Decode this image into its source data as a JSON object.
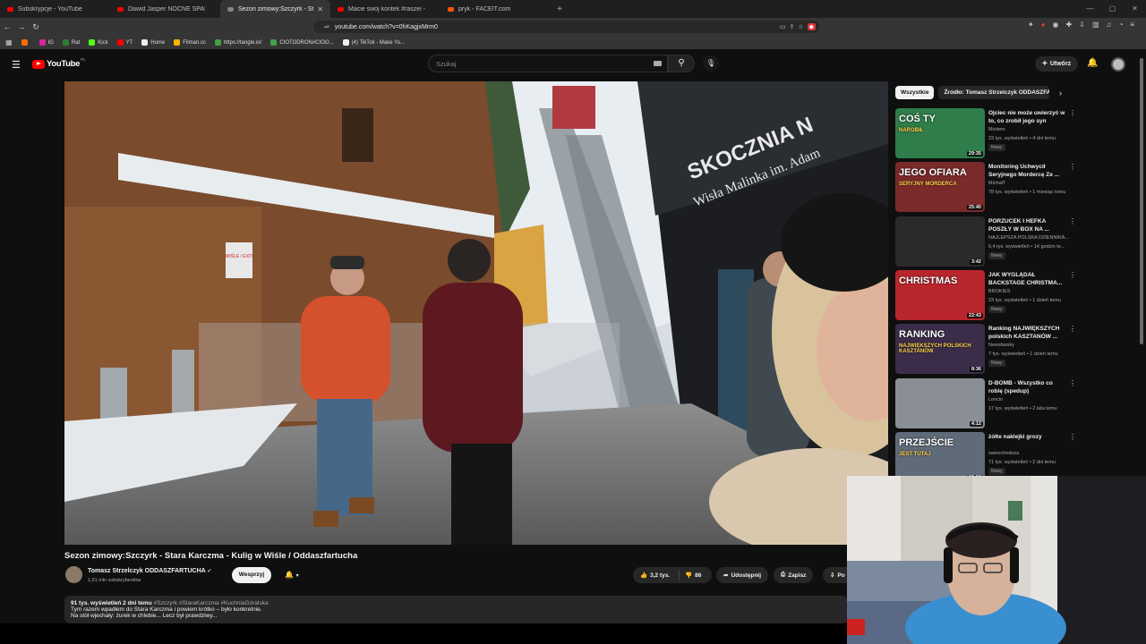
{
  "browser": {
    "tabs": [
      {
        "label": "Subskrypcje - YouTube"
      },
      {
        "label": "Dawid Jasper NOCNE SPANIE #61 -"
      },
      {
        "label": "Sezon zimowy:Szczyrk - Stara",
        "active": true
      },
      {
        "label": "Macie swój kontek #raszei - YouTube"
      },
      {
        "label": "pryk - FACEIT.com"
      }
    ],
    "new_tab": "+",
    "url": "youtube.com/watch?v=0hKagjxMrm0",
    "bookmarks": [
      {
        "label": "",
        "color": "#ff6d00"
      },
      {
        "label": "IG",
        "color": "#d6249f"
      },
      {
        "label": "Rat",
        "color": "#2e7d32"
      },
      {
        "label": "Kick",
        "color": "#53fc18"
      },
      {
        "label": "YT",
        "color": "#ff0000"
      },
      {
        "label": "Home",
        "color": "#eeeeee"
      },
      {
        "label": "Filman.cc",
        "color": "#ffb300"
      },
      {
        "label": "https://tangle.io/",
        "color": "#43a047"
      },
      {
        "label": "CIOTODRON#CIOO...",
        "color": "#43a047"
      },
      {
        "label": "(4) TikTok - Make Yo...",
        "color": "#eeeeee"
      }
    ]
  },
  "youtube": {
    "logo_text": "YouTube",
    "country": "PL",
    "search_placeholder": "Szukaj",
    "create_label": "Utwórz"
  },
  "video": {
    "title": "Sezon zimowy:Szczyrk - Stara Karczma - Kulig w Wiśle / Oddaszfartucha",
    "channel": "Tomasz Strzelczyk ODDASZFARTUCHA",
    "subscribers": "1,61 mln subskrybentów",
    "support_label": "Wesprzyj",
    "likes": "3,2 tys.",
    "dislikes": "86",
    "share_label": "Udostępnij",
    "save_label": "Zapisz",
    "download_label": "Po",
    "sign_left": "WIŚLE / EXIT",
    "sign_building": "SKOCZNIA N",
    "sign_building_2": "Wisła Malinka im. Adam",
    "description": {
      "meta": "91 tys. wyświetleń  2 dni temu",
      "tags": "#Szczyrk #StaraKarczma #KuchniaGóralska",
      "line1": "Tym razem wpadłem do Stara Karczma i powiem krótko – było konkretnie.",
      "line2": "Na stół wjechały: żurek w chlebie... Lecz był prawdziwy..."
    }
  },
  "sidebar": {
    "chips": [
      {
        "label": "Wszystkie",
        "active": true
      },
      {
        "label": "Źródło: Tomasz Strzelczyk ODDASZFA"
      }
    ],
    "recommendations": [
      {
        "title": "Ojciec nie może uwierzyć w to, co zrobił jego syn",
        "channel": "Mortem",
        "views": "23 tys. wyświetleń • 4 dni temu",
        "badge": "Nowy",
        "duration": "29:35",
        "thumb_text": "COŚ TY",
        "thumb_sub": "NAROBIŁ",
        "thumb_color": "#2f7d4a"
      },
      {
        "title": "Monitoring Uchwycił Seryjnego Mordercę Ze ...",
        "channel": "MichałT",
        "views": "78 tys. wyświetleń • 1 miesiąc temu",
        "badge": "",
        "duration": "25:40",
        "thumb_text": "JEGO OFIARA",
        "thumb_sub": "SERYJNY MORDERCA",
        "thumb_color": "#7a2a2a"
      },
      {
        "title": "PORZUCEK I HEFKA POSZŁY W BOX NA ...",
        "channel": "NAJLEPSZA POLSKA DZIENNIKA...",
        "views": "6,4 tys. wyświetleń • 14 godzin te...",
        "badge": "Nowy",
        "duration": "3:42",
        "thumb_text": "",
        "thumb_sub": "",
        "thumb_color": "#2a2a2a"
      },
      {
        "title": "JAK WYGLĄDAŁ BACKSTAGE CHRISTMA...",
        "channel": "BROKIES",
        "views": "23 tys. wyświetleń • 1 dzień temu",
        "badge": "Nowy",
        "duration": "22:43",
        "thumb_text": "CHRISTMAS",
        "thumb_sub": "",
        "thumb_color": "#b8262c"
      },
      {
        "title": "Ranking NAJWIĘKSZYCH polskich KASZTANÓW ...",
        "channel": "Newsbwsky",
        "views": "7 tys. wyświetleń • 1 dzień temu",
        "badge": "Nowy",
        "duration": "8:36",
        "thumb_text": "RANKING",
        "thumb_sub": "NAJWIĘKSZYCH POLSKICH KASZTANÓW",
        "thumb_color": "#3b2d4a"
      },
      {
        "title": "D-BOMB - Wszystko co robię  (spedup)",
        "channel": "Loncin",
        "views": "17 tys. wyświetleń • 2 lata temu",
        "badge": "",
        "duration": "4:12",
        "thumb_text": "",
        "thumb_sub": "",
        "thumb_color": "#8a8f96"
      },
      {
        "title": "żółte naklejki grozy",
        "channel": "samochodoza",
        "views": "71 tys. wyświetleń • 2 dni temu",
        "badge": "Nowy",
        "duration": "15:18",
        "thumb_text": "PRZEJŚCIE",
        "thumb_sub": "JEST TUTAJ",
        "thumb_color": "#5f6b78"
      }
    ]
  },
  "colors": {
    "bg": "#0f0f0f",
    "brand": "#ff0000",
    "chip": "#272727"
  }
}
